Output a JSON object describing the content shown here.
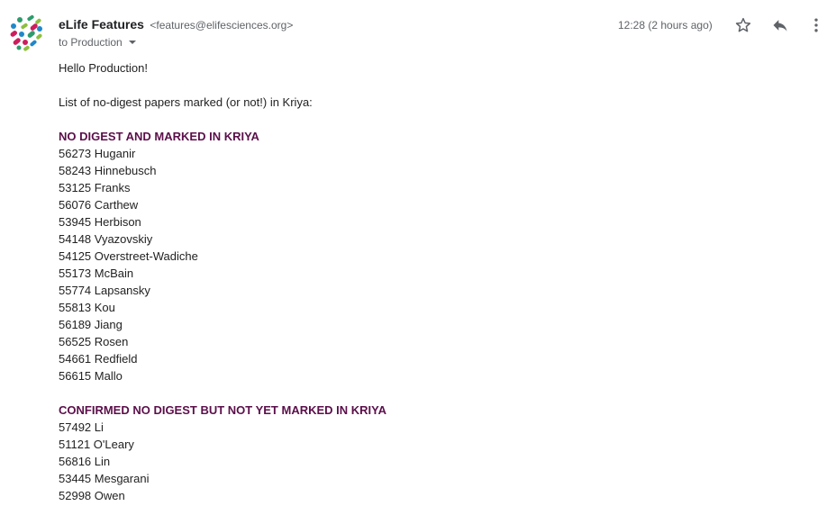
{
  "message": {
    "sender_name": "eLife Features",
    "sender_email": "<features@elifesciences.org>",
    "recipient": "to Production",
    "timestamp": "12:28 (2 hours ago)",
    "icons": {
      "avatar": "elife-logo-avatar",
      "recipient_toggle": "chevron-down-icon",
      "star": "star-icon",
      "reply": "reply-icon",
      "more": "more-vertical-icon"
    }
  },
  "body": {
    "greeting": "Hello Production!",
    "intro": "List of no-digest papers marked (or not!) in Kriya:",
    "sections": [
      {
        "heading": "NO DIGEST AND MARKED IN KRIYA",
        "items": [
          "56273 Huganir",
          "58243 Hinnebusch",
          "53125 Franks",
          "56076 Carthew",
          "53945 Herbison",
          "54148 Vyazovskiy",
          "54125 Overstreet-Wadiche",
          "55173 McBain",
          "55774 Lapsansky",
          "55813 Kou",
          "56189 Jiang",
          "56525 Rosen",
          "54661 Redfield",
          "56615 Mallo"
        ]
      },
      {
        "heading": "CONFIRMED NO DIGEST BUT NOT YET MARKED IN KRIYA",
        "items": [
          "57492 Li",
          "51121 O'Leary",
          "56816 Lin",
          "53445 Mesgarani",
          "52998 Owen"
        ]
      }
    ]
  },
  "colors": {
    "heading": "#5b0f4a",
    "body_text": "#222222",
    "secondary_text": "#5f6368"
  }
}
